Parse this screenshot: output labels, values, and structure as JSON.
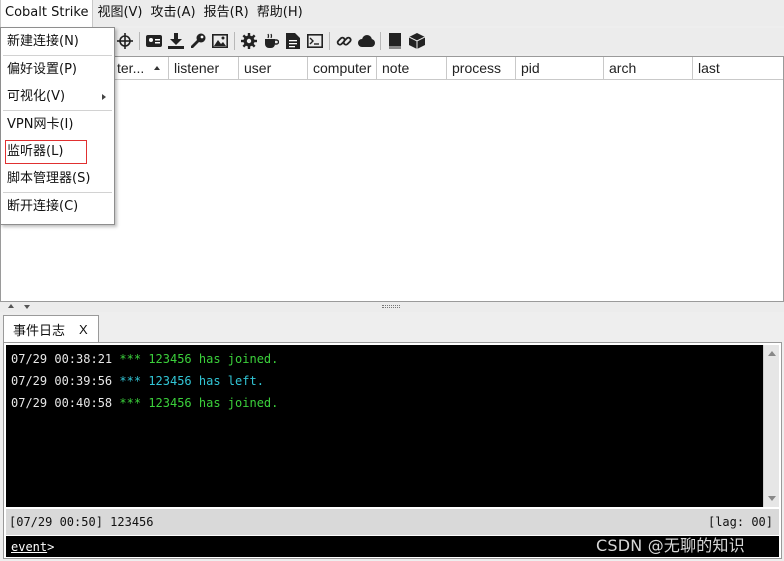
{
  "menubar": {
    "items": [
      {
        "label": "Cobalt Strike"
      },
      {
        "label": "视图(V)"
      },
      {
        "label": "攻击(A)"
      },
      {
        "label": "报告(R)"
      },
      {
        "label": "帮助(H)"
      }
    ]
  },
  "toolbar": {
    "icons": [
      "list-icon",
      "crosshair-icon",
      "card-icon",
      "download-icon",
      "key-icon",
      "image-icon",
      "gear-icon",
      "coffee-icon",
      "document-icon",
      "terminal-icon",
      "link-icon",
      "cloud-icon",
      "book-icon",
      "cube-icon"
    ]
  },
  "dropdown": {
    "items": [
      {
        "label": "新建连接(N)"
      },
      {
        "label": "偏好设置(P)"
      },
      {
        "label": "可视化(V)"
      },
      {
        "label": "VPN网卡(I)"
      },
      {
        "label": "监听器(L)"
      },
      {
        "label": "脚本管理器(S)"
      },
      {
        "label": "断开连接(C)"
      }
    ]
  },
  "table": {
    "columns": [
      {
        "label": "ter..."
      },
      {
        "label": "listener"
      },
      {
        "label": "user"
      },
      {
        "label": "computer"
      },
      {
        "label": "note"
      },
      {
        "label": "process"
      },
      {
        "label": "pid"
      },
      {
        "label": "arch"
      },
      {
        "label": "last"
      }
    ]
  },
  "tab": {
    "label": "事件日志",
    "close": "X"
  },
  "console": {
    "lines": [
      {
        "ts": "07/29 00:38:21",
        "stars": "***",
        "user": "123456",
        "msg": "has joined.",
        "color": "#3bd03b"
      },
      {
        "ts": "07/29 00:39:56",
        "stars": "***",
        "user": "123456",
        "msg": "has left.",
        "color": "#32c6d6"
      },
      {
        "ts": "07/29 00:40:58",
        "stars": "***",
        "user": "123456",
        "msg": "has joined.",
        "color": "#3bd03b"
      }
    ],
    "status_left": "[07/29 00:50] 123456",
    "status_right": "[lag: 00]",
    "prompt": "event",
    "prompt_suffix": ">"
  },
  "watermark": "CSDN @无聊的知识"
}
